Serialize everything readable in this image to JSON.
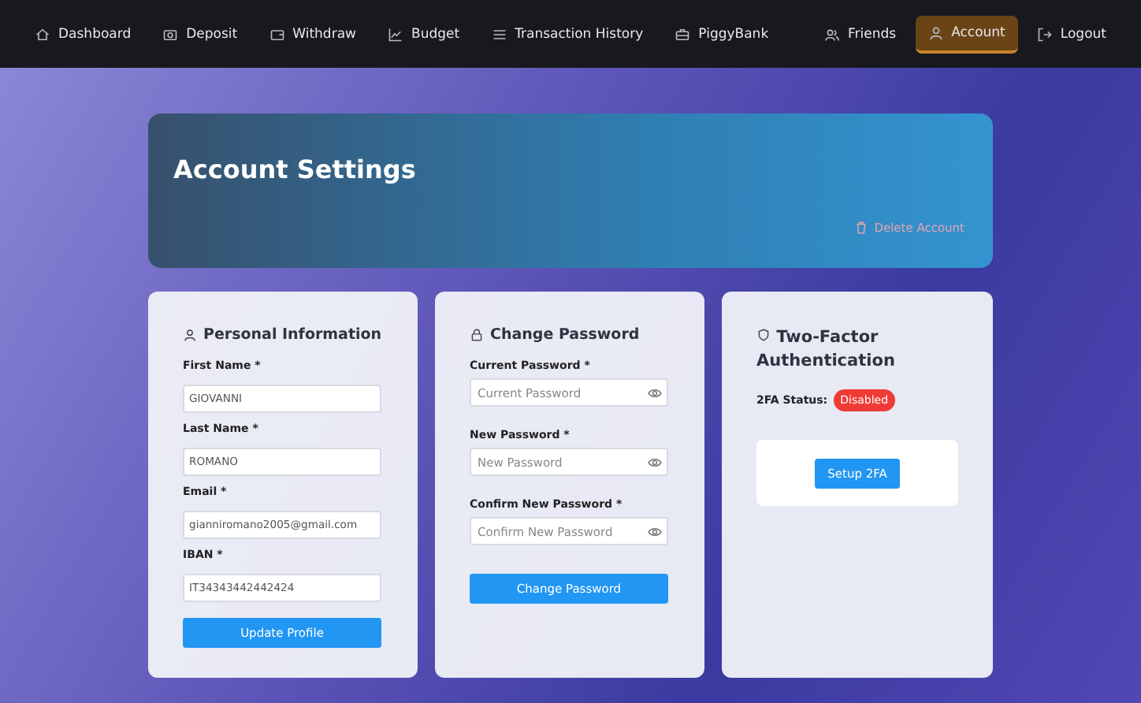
{
  "nav": {
    "left": [
      {
        "label": "Dashboard",
        "selected": false
      },
      {
        "label": "Deposit",
        "selected": false
      },
      {
        "label": "Withdraw",
        "selected": false
      },
      {
        "label": "Budget",
        "selected": false
      },
      {
        "label": "Transaction History",
        "selected": false
      },
      {
        "label": "PiggyBank",
        "selected": false
      }
    ],
    "right": [
      {
        "label": "Friends",
        "selected": false
      },
      {
        "label": "Account",
        "selected": true
      },
      {
        "label": "Logout",
        "selected": false
      }
    ]
  },
  "header": {
    "title": "Account Settings",
    "delete_button": "Delete Account"
  },
  "personal": {
    "title": "Personal Information",
    "fields": [
      {
        "label": "First Name *",
        "value": "GIOVANNI"
      },
      {
        "label": "Last Name *",
        "value": "ROMANO"
      },
      {
        "label": "Email *",
        "value": "gianniromano2005@gmail.com"
      },
      {
        "label": "IBAN *",
        "value": "IT34343442442424"
      }
    ],
    "button": "Update Profile"
  },
  "password": {
    "title": "Change Password",
    "fields": [
      {
        "label": "Current Password *",
        "placeholder": "Current Password"
      },
      {
        "label": "New Password *",
        "placeholder": "New Password"
      },
      {
        "label": "Confirm New Password *",
        "placeholder": "Confirm New Password"
      }
    ],
    "button": "Change Password"
  },
  "two_factor": {
    "title": "Two-Factor Authentication",
    "status_label": "2FA Status:",
    "status": "Disabled",
    "enabled": false,
    "button": "Setup 2FA"
  }
}
